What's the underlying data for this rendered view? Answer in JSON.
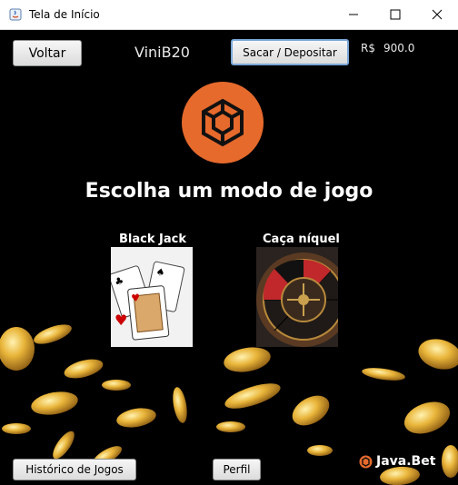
{
  "window": {
    "title": "Tela de Início"
  },
  "header": {
    "back_label": "Voltar",
    "username": "ViniB20",
    "deposit_label": "Sacar / Depositar",
    "currency": "R$",
    "balance": "900.0"
  },
  "main": {
    "heading": "Escolha um modo de jogo",
    "games": [
      {
        "label": "Black  Jack",
        "icon": "playing-cards-image"
      },
      {
        "label": "Caça níquel",
        "icon": "roulette-wheel-image"
      }
    ]
  },
  "footer": {
    "history_label": "Histórico de Jogos",
    "profile_label": "Perfil",
    "brand": "Java.Bet"
  },
  "colors": {
    "brand_orange": "#e66a2c",
    "background": "#000000",
    "coin_gold": "#e9b53a"
  }
}
